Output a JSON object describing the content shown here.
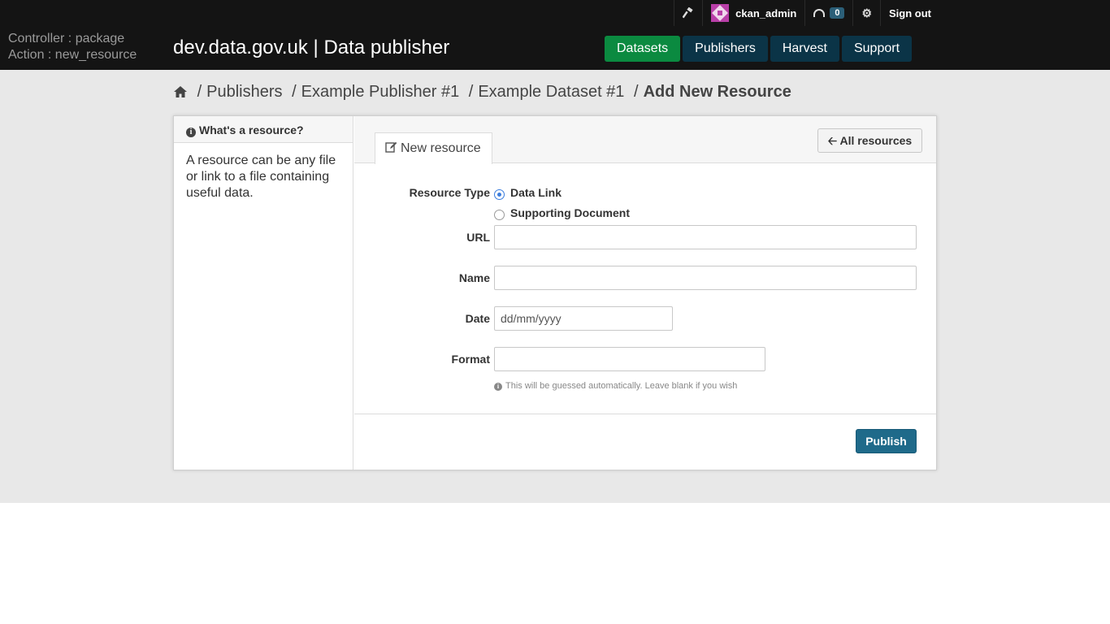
{
  "header": {
    "debug_controller": "Controller : package",
    "debug_action": "Action : new_resource",
    "brand": "dev.data.gov.uk | Data publisher",
    "username": "ckan_admin",
    "dashboard_count": "0",
    "sign_out": "Sign out",
    "nav": [
      {
        "label": "Datasets",
        "active": true
      },
      {
        "label": "Publishers",
        "active": false
      },
      {
        "label": "Harvest",
        "active": false
      },
      {
        "label": "Support",
        "active": false
      }
    ]
  },
  "breadcrumb": {
    "items": [
      "Publishers",
      "Example Publisher #1",
      "Example Dataset #1"
    ],
    "current": "Add New Resource"
  },
  "sidebar": {
    "heading": "What's a resource?",
    "body": "A resource can be any file or link to a file containing useful data."
  },
  "main": {
    "tab_label": "New resource",
    "all_resources": "All resources",
    "form": {
      "resource_type_label": "Resource Type",
      "options": [
        "Data Link",
        "Supporting Document"
      ],
      "selected": "Data Link",
      "url_label": "URL",
      "url_value": "",
      "name_label": "Name",
      "name_value": "",
      "date_label": "Date",
      "date_placeholder": "dd/mm/yyyy",
      "format_label": "Format",
      "format_value": "",
      "format_hint": "This will be guessed automatically. Leave blank if you wish"
    },
    "publish": "Publish"
  },
  "colors": {
    "topbar": "#141414",
    "nav_active": "#0b8a40",
    "nav_item": "#0b3447",
    "publish": "#1f6a8a",
    "radio_selected": "#3b7ddd"
  }
}
